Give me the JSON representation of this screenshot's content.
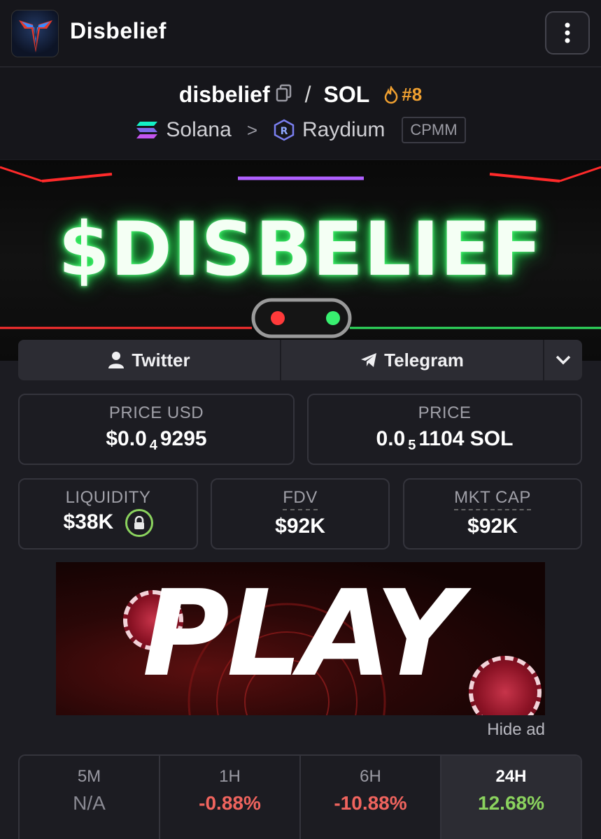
{
  "app": {
    "title": "Disbelief"
  },
  "pair": {
    "base": "disbelief",
    "separator": "/",
    "quote": "SOL",
    "rank": "#8",
    "chain": "Solana",
    "dex": "Raydium",
    "pool_type": "CPMM"
  },
  "banner": {
    "text": "$DISBELIEF"
  },
  "socials": {
    "twitter": "Twitter",
    "telegram": "Telegram"
  },
  "stats": {
    "price_usd": {
      "label": "PRICE USD",
      "prefix": "$0.0",
      "zeros": "4",
      "digits": "9295"
    },
    "price": {
      "label": "PRICE",
      "prefix": "0.0",
      "zeros": "5",
      "digits": "1104 SOL"
    },
    "liquidity": {
      "label": "LIQUIDITY",
      "value": "$38K"
    },
    "fdv": {
      "label": "FDV",
      "value": "$92K"
    },
    "mkt_cap": {
      "label": "MKT CAP",
      "value": "$92K"
    }
  },
  "ad": {
    "text": "PLAY",
    "hide_label": "Hide ad"
  },
  "timeframes": [
    {
      "label": "5M",
      "value": "N/A",
      "color": "#8a8a93"
    },
    {
      "label": "1H",
      "value": "-0.88%",
      "color": "#f0645e"
    },
    {
      "label": "6H",
      "value": "-10.88%",
      "color": "#f0645e"
    },
    {
      "label": "24H",
      "value": "12.68%",
      "color": "#8bd35e"
    }
  ],
  "colors": {
    "accent_orange": "#f0a030",
    "positive": "#8bd35e",
    "negative": "#f0645e"
  }
}
